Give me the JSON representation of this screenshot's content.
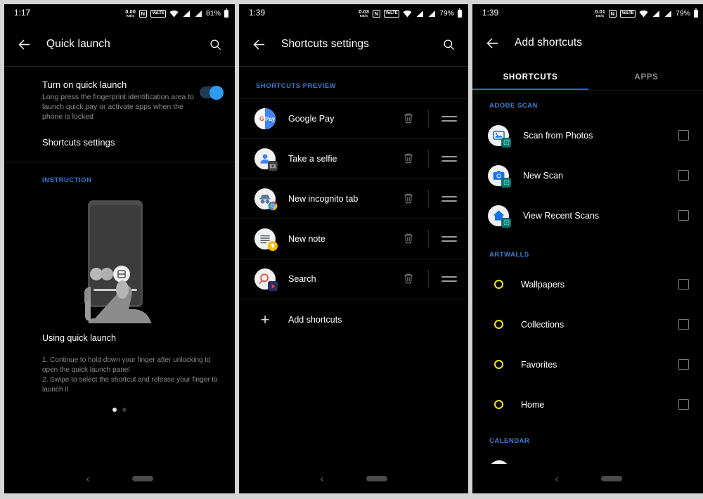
{
  "panels": [
    {
      "status": {
        "clock": "1:17",
        "net_rate": "0.00",
        "net_unit": "KB/S",
        "nfc": "N",
        "volte": "VoLTE",
        "battery": "81%"
      },
      "appbar": {
        "title": "Quick launch",
        "back_icon": "arrow-left-icon",
        "search_icon": "search-icon"
      },
      "toggle_row": {
        "title": "Turn on quick launch",
        "subtitle": "Long press the fingerprint identification area to launch quick pay or activate apps when the phone is locked",
        "state": "on"
      },
      "shortcuts_settings_label": "Shortcuts settings",
      "instruction_label": "INSTRUCTION",
      "using_title": "Using quick launch",
      "using_body": "1. Continue to hold down your finger after unlocking to open the quick launch panel\n2. Swipe to select the shortcut and release your finger to launch it",
      "pager": {
        "count": 2,
        "active": 0
      }
    },
    {
      "status": {
        "clock": "1:39",
        "net_rate": "0.03",
        "net_unit": "KB/S",
        "nfc": "N",
        "volte": "VoLTE",
        "battery": "79%"
      },
      "appbar": {
        "title": "Shortcuts settings",
        "back_icon": "arrow-left-icon",
        "search_icon": "search-icon"
      },
      "preview_label": "SHORTCUTS PREVIEW",
      "shortcuts": [
        {
          "name": "Google Pay",
          "icon": "google-pay-icon",
          "badge": "none"
        },
        {
          "name": "Take a selfie",
          "icon": "person-icon",
          "badge": "camera-badge"
        },
        {
          "name": "New incognito tab",
          "icon": "incognito-icon",
          "badge": "chrome-badge"
        },
        {
          "name": "New note",
          "icon": "note-lines-icon",
          "badge": "keep-badge"
        },
        {
          "name": "Search",
          "icon": "magnifier-red-icon",
          "badge": "play-badge"
        }
      ],
      "delete_icon": "trash-icon",
      "drag_icon": "drag-handle-icon",
      "add_row": {
        "label": "Add shortcuts",
        "icon": "plus-icon"
      }
    },
    {
      "status": {
        "clock": "1:39",
        "net_rate": "0.01",
        "net_unit": "KB/S",
        "nfc": "N",
        "volte": "VoLTE",
        "battery": "79%"
      },
      "appbar": {
        "title": "Add shortcuts",
        "back_icon": "arrow-left-icon"
      },
      "tabs": [
        {
          "label": "SHORTCUTS",
          "active": true
        },
        {
          "label": "APPS",
          "active": false
        }
      ],
      "groups": [
        {
          "label": "ADOBE SCAN",
          "items": [
            {
              "name": "Scan from Photos",
              "icon": "photo-scan-icon",
              "badge": "adobe-scan-badge",
              "checked": false
            },
            {
              "name": "New Scan",
              "icon": "camera-icon",
              "badge": "adobe-scan-badge",
              "checked": false
            },
            {
              "name": "View Recent Scans",
              "icon": "home-icon",
              "badge": "adobe-scan-badge",
              "checked": false
            }
          ]
        },
        {
          "label": "ARTWALLS",
          "items": [
            {
              "name": "Wallpapers",
              "icon": "yellow-ring-icon",
              "badge": "none",
              "checked": false
            },
            {
              "name": "Collections",
              "icon": "yellow-ring-icon",
              "badge": "none",
              "checked": false
            },
            {
              "name": "Favorites",
              "icon": "yellow-ring-icon",
              "badge": "none",
              "checked": false
            },
            {
              "name": "Home",
              "icon": "yellow-ring-icon",
              "badge": "none",
              "checked": false
            }
          ]
        },
        {
          "label": "CALENDAR",
          "items": []
        }
      ]
    }
  ],
  "navbar": {
    "back_icon": "nav-back-icon",
    "home_pill_icon": "nav-home-pill-icon"
  },
  "colors": {
    "accent_blue": "#2f7bd0",
    "tab_indicator": "#1e6fd0",
    "switch_on": "#2f9bf0",
    "ring_yellow": "#f2e31c",
    "bg": "#000000"
  }
}
